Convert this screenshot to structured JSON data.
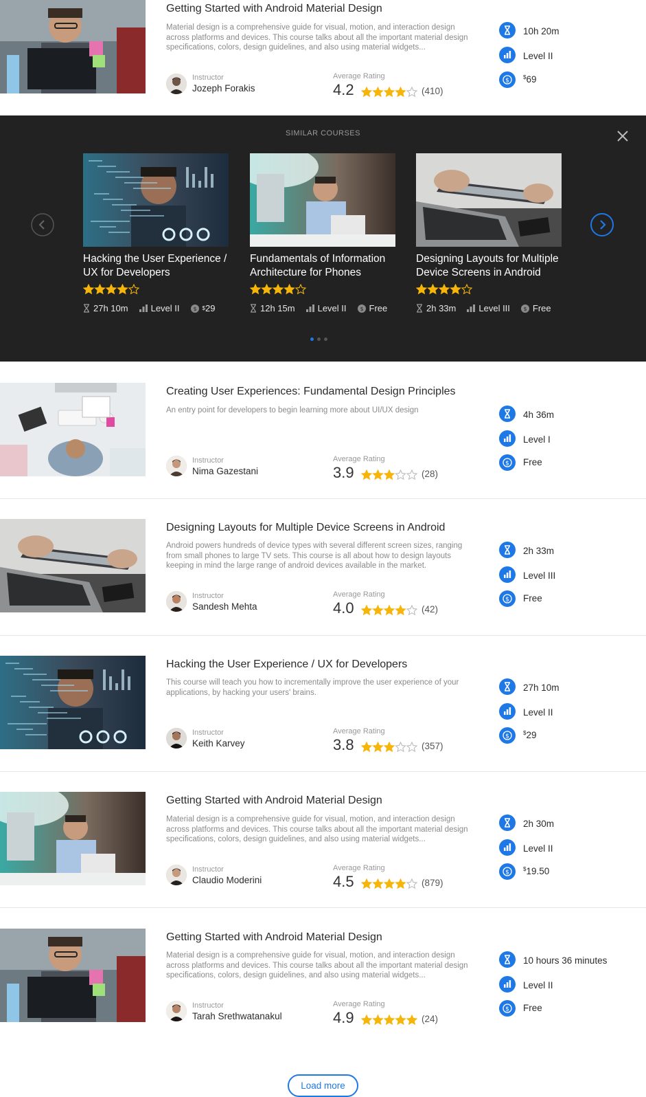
{
  "courses": [
    {
      "title": "Getting Started with Android Material Design",
      "description": "Material design is a comprehensive guide for visual, motion, and interaction design across platforms and devices. This course talks about all the important material design specifications, colors, design guidelines, and also using material widgets...",
      "instructor_label": "Instructor",
      "instructor": "Jozeph Forakis",
      "rating_label": "Average Rating",
      "rating": "4.2",
      "stars_filled": 4,
      "rating_count": "(410)",
      "duration": "10h 20m",
      "level": "Level II",
      "price_symbol": "$",
      "price": "69",
      "image": "man-with-glasses-at-laptop"
    },
    {
      "title": "Creating User Experiences: Fundamental Design Principles",
      "description": "An entry point for developers to begin learning more about UI/UX design",
      "instructor_label": "Instructor",
      "instructor": "Nima Gazestani",
      "rating_label": "Average Rating",
      "rating": "3.9",
      "stars_filled": 3,
      "rating_count": "(28)",
      "duration": "4h 36m",
      "level": "Level I",
      "price_symbol": "",
      "price": "Free",
      "image": "desk-top-view"
    },
    {
      "title": "Designing Layouts for Multiple Device Screens in Android",
      "description": "Android powers hundreds of device types with several different screen sizes, ranging from small phones to large TV sets. This course is all about how to design layouts keeping in mind the large range of android devices available in the market.",
      "instructor_label": "Instructor",
      "instructor": "Sandesh Mehta",
      "rating_label": "Average Rating",
      "rating": "4.0",
      "stars_filled": 4,
      "rating_count": "(42)",
      "duration": "2h 33m",
      "level": "Level III",
      "price_symbol": "",
      "price": "Free",
      "image": "hands-with-tablet"
    },
    {
      "title": "Hacking the User Experience / UX for Developers",
      "description": "This course will teach you how to incrementally improve the user experience of your applications, by hacking your users' brains.",
      "instructor_label": "Instructor",
      "instructor": "Keith Karvey",
      "rating_label": "Average Rating",
      "rating": "3.8",
      "stars_filled": 3,
      "rating_count": "(357)",
      "duration": "27h 10m",
      "level": "Level II",
      "price_symbol": "$",
      "price": "29",
      "image": "man-with-code-overlay"
    },
    {
      "title": "Getting Started with Android Material Design",
      "description": "Material design is a comprehensive guide for visual, motion, and interaction design across platforms and devices. This course talks about all the important material design specifications, colors, design guidelines, and also using material widgets...",
      "instructor_label": "Instructor",
      "instructor": "Claudio Moderini",
      "rating_label": "Average Rating",
      "rating": "4.5",
      "stars_filled": 4,
      "rating_count": "(879)",
      "duration": "2h 30m",
      "level": "Level II",
      "price_symbol": "$",
      "price": "19.50",
      "image": "man-on-phone-at-computer"
    },
    {
      "title": "Getting Started with Android Material Design",
      "description": "Material design is a comprehensive guide for visual, motion, and interaction design across platforms and devices. This course talks about all the important material design specifications, colors, design guidelines, and also using material widgets...",
      "instructor_label": "Instructor",
      "instructor": "Tarah Srethwatanakul",
      "rating_label": "Average Rating",
      "rating": "4.9",
      "stars_filled": 5,
      "rating_count": "(24)",
      "duration": "10 hours 36 minutes",
      "level": "Level II",
      "price_symbol": "",
      "price": "Free",
      "image": "man-with-glasses-at-laptop"
    }
  ],
  "similar": {
    "heading": "SIMILAR COURSES",
    "active_page": 0,
    "page_count": 3,
    "cards": [
      {
        "title": "Hacking the User Experience / UX for Developers",
        "stars_filled": 4,
        "duration": "27h 10m",
        "level": "Level II",
        "price_symbol": "$",
        "price": "29",
        "image": "man-with-code-overlay"
      },
      {
        "title": "Fundamentals of Information Architecture for Phones",
        "stars_filled": 4,
        "duration": "12h 15m",
        "level": "Level II",
        "price_symbol": "",
        "price": "Free",
        "image": "man-on-phone-at-computer"
      },
      {
        "title": "Designing Layouts for Multiple Device Screens in Android",
        "stars_filled": 4,
        "duration": "2h 33m",
        "level": "Level III",
        "price_symbol": "",
        "price": "Free",
        "image": "hands-with-tablet"
      }
    ]
  },
  "load_more_label": "Load more",
  "colors": {
    "accent": "#1e78e6",
    "star": "#f5b50a",
    "panel": "#222222"
  }
}
